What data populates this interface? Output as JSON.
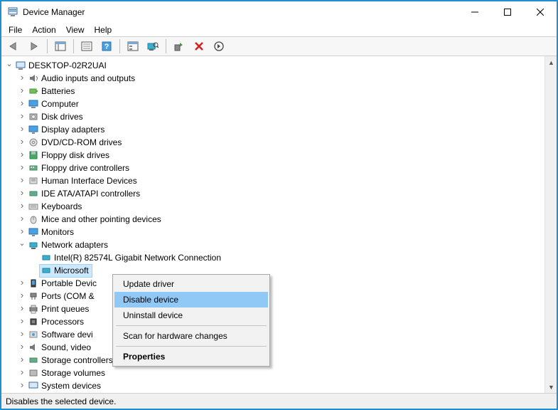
{
  "window": {
    "title": "Device Manager"
  },
  "menu": {
    "file": "File",
    "action": "Action",
    "view": "View",
    "help": "Help"
  },
  "statusbar": "Disables the selected device.",
  "root": "DESKTOP-02R2UAI",
  "categories": {
    "audio": "Audio inputs and outputs",
    "batteries": "Batteries",
    "computer": "Computer",
    "disk": "Disk drives",
    "display": "Display adapters",
    "dvd": "DVD/CD-ROM drives",
    "floppyDrives": "Floppy disk drives",
    "floppyCtrl": "Floppy drive controllers",
    "hid": "Human Interface Devices",
    "ide": "IDE ATA/ATAPI controllers",
    "keyboards": "Keyboards",
    "mice": "Mice and other pointing devices",
    "monitors": "Monitors",
    "network": "Network adapters",
    "portable": "Portable Devic",
    "ports": "Ports (COM &",
    "printq": "Print queues",
    "processors": "Processors",
    "swdev": "Software devi",
    "sound": "Sound, video",
    "storagectrl": "Storage controllers",
    "storagevol": "Storage volumes",
    "sysdev": "System devices"
  },
  "network_children": {
    "intel": "Intel(R) 82574L Gigabit Network Connection",
    "microsoft": "Microsoft"
  },
  "context_menu": {
    "update": "Update driver",
    "disable": "Disable device",
    "uninstall": "Uninstall device",
    "scan": "Scan for hardware changes",
    "properties": "Properties"
  }
}
